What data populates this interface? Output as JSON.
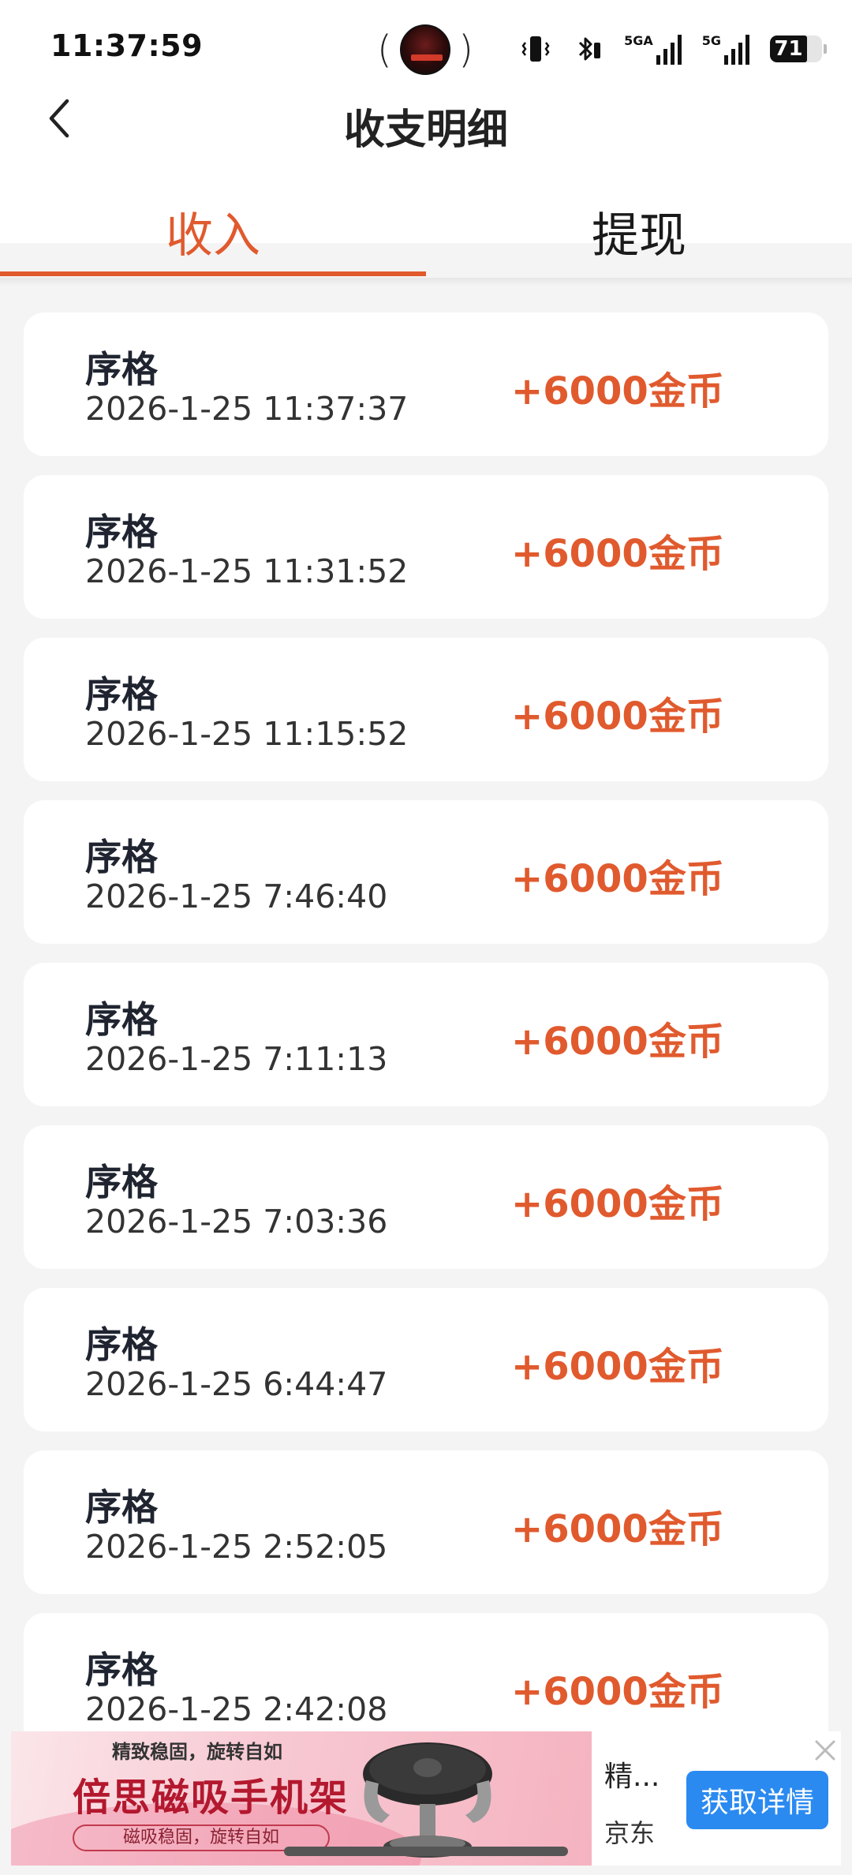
{
  "status_bar": {
    "time": "11:37:59",
    "battery_level": "71",
    "network_1_label": "5GA",
    "network_2_label": "5G",
    "icons": [
      "vibrate-icon",
      "bluetooth-icon",
      "signal-icon",
      "signal-icon",
      "battery-icon"
    ]
  },
  "header": {
    "title": "收支明细",
    "back_icon": "chevron-left-icon"
  },
  "tabs": [
    {
      "label": "收入",
      "active": true
    },
    {
      "label": "提现",
      "active": false
    }
  ],
  "records": [
    {
      "name": "序格",
      "time": "2026-1-25 11:37:37",
      "amount": "+6000金币"
    },
    {
      "name": "序格",
      "time": "2026-1-25 11:31:52",
      "amount": "+6000金币"
    },
    {
      "name": "序格",
      "time": "2026-1-25 11:15:52",
      "amount": "+6000金币"
    },
    {
      "name": "序格",
      "time": "2026-1-25 7:46:40",
      "amount": "+6000金币"
    },
    {
      "name": "序格",
      "time": "2026-1-25 7:11:13",
      "amount": "+6000金币"
    },
    {
      "name": "序格",
      "time": "2026-1-25 7:03:36",
      "amount": "+6000金币"
    },
    {
      "name": "序格",
      "time": "2026-1-25 6:44:47",
      "amount": "+6000金币"
    },
    {
      "name": "序格",
      "time": "2026-1-25 2:52:05",
      "amount": "+6000金币"
    },
    {
      "name": "序格",
      "time": "2026-1-25 2:42:08",
      "amount": "+6000金币"
    }
  ],
  "ad": {
    "top_line": "精致稳固，旋转自如",
    "headline": "倍思磁吸手机架",
    "sub": "磁吸稳固，旋转自如",
    "desc": "精...",
    "source": "京东",
    "cta": "获取详情"
  },
  "colors": {
    "accent": "#e05a2e",
    "cta": "#2a8af0",
    "background": "#f4f4f4"
  }
}
